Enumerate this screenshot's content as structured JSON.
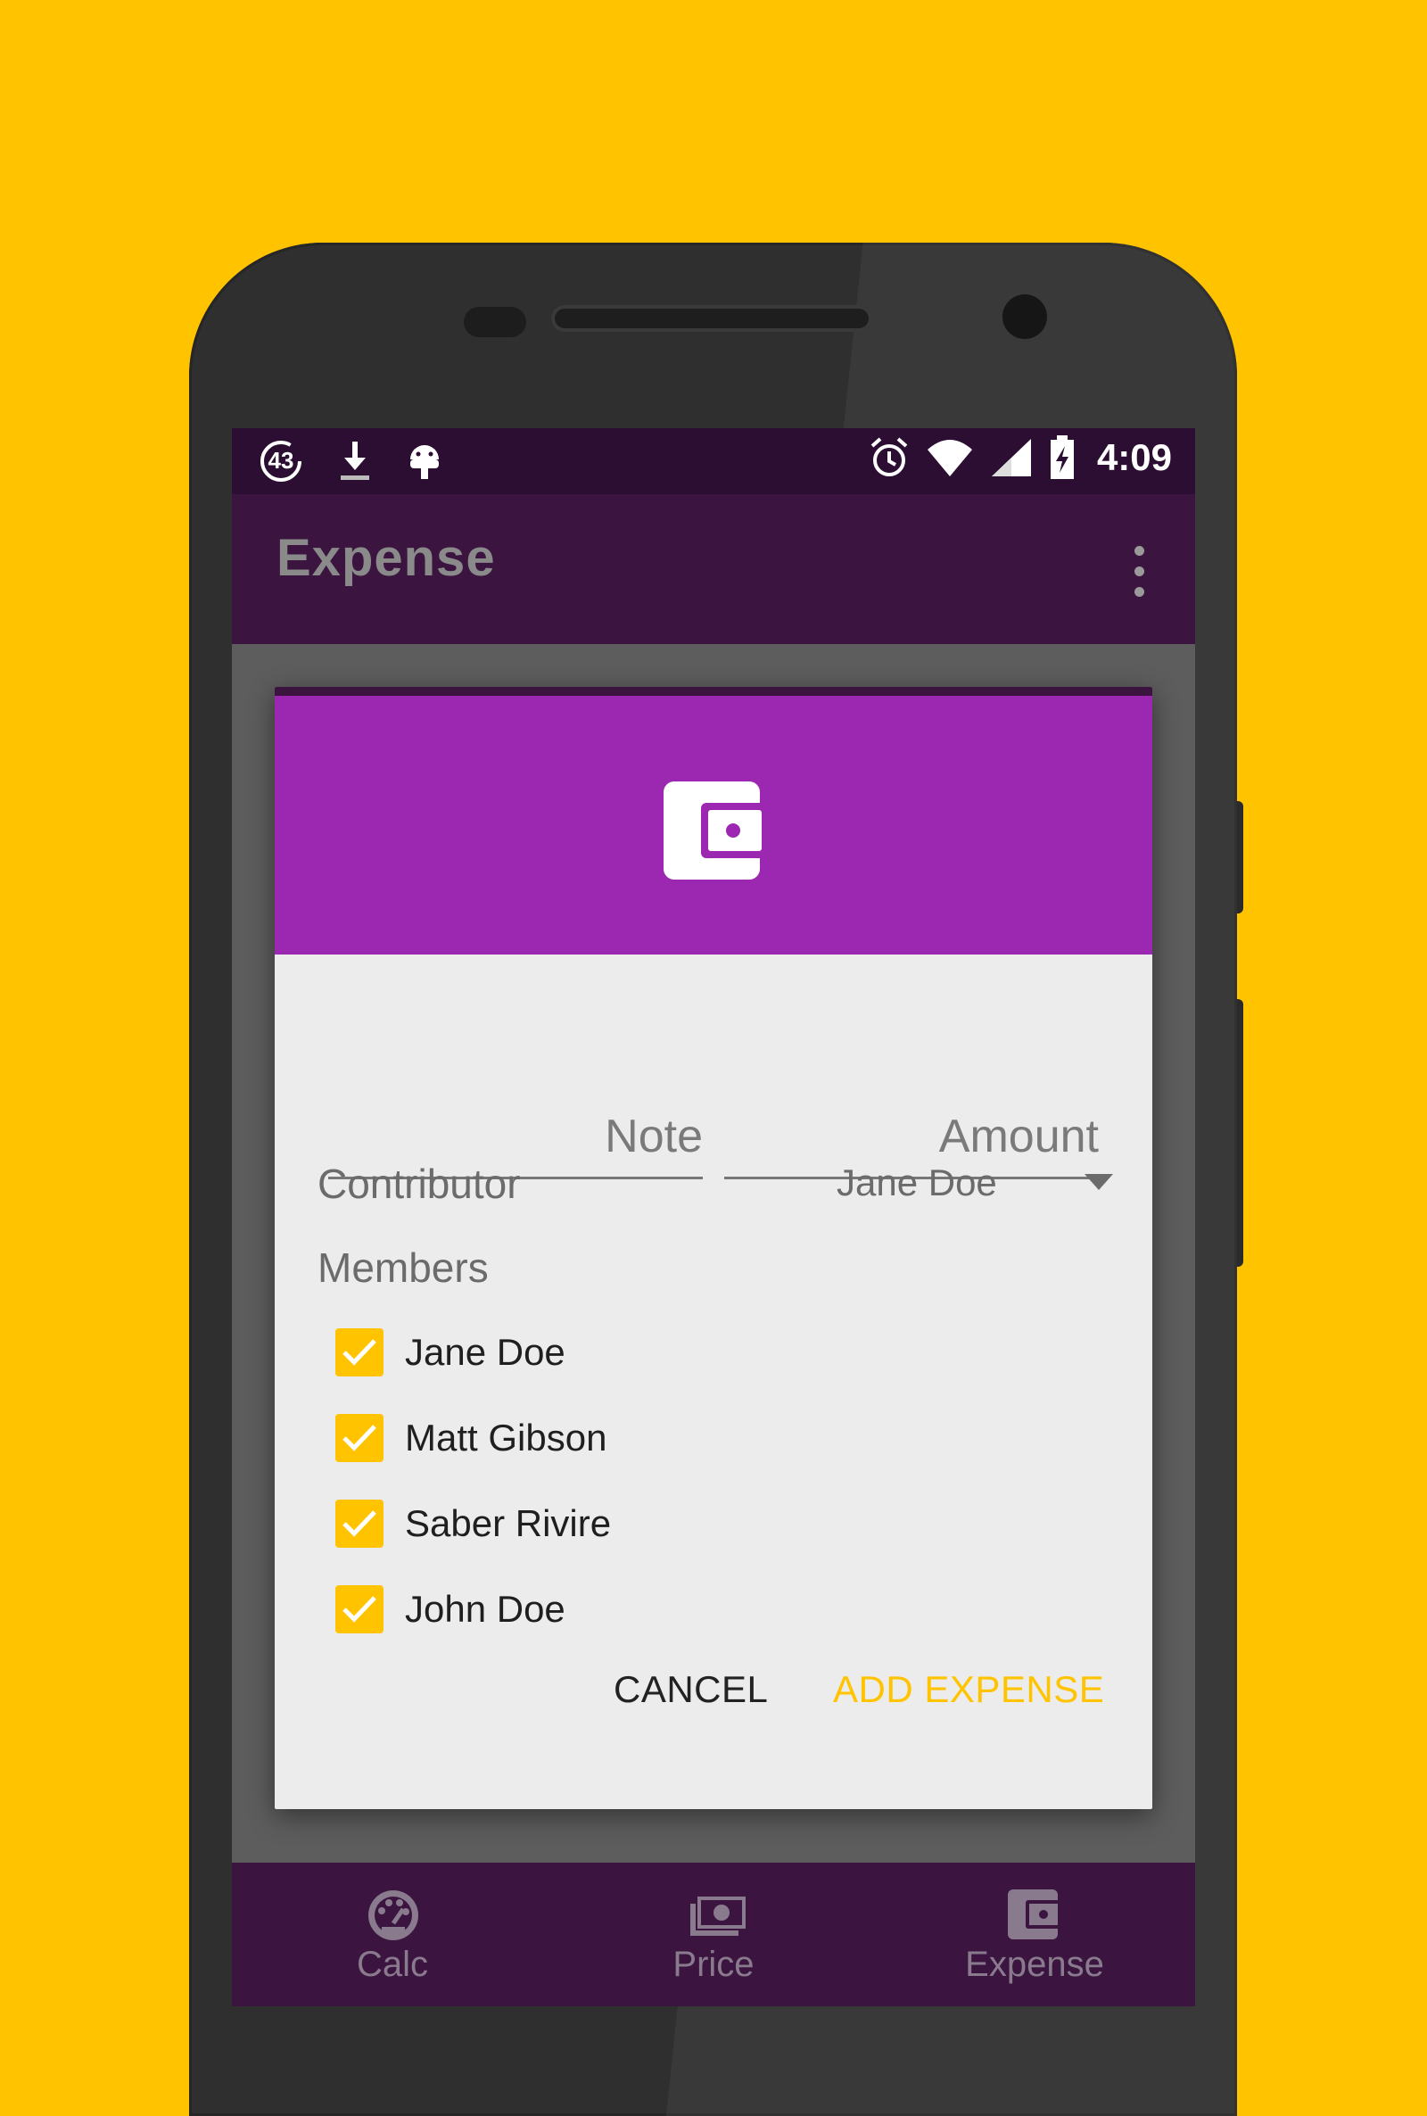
{
  "status_bar": {
    "notification_badge": "43",
    "time": "4:09",
    "icons": [
      "notification-count-icon",
      "download-icon",
      "android-icon",
      "alarm-icon",
      "wifi-icon",
      "signal-icon",
      "battery-charging-icon"
    ]
  },
  "app_bar": {
    "title": "Expense",
    "overflow_icon": "more-vert-icon"
  },
  "dialog": {
    "header_icon": "wallet-icon",
    "note_placeholder": "Note",
    "amount_placeholder": "Amount",
    "contributor_label": "Contributor",
    "contributor_value": "Jane Doe",
    "members_label": "Members",
    "members": [
      {
        "name": "Jane Doe",
        "checked": true
      },
      {
        "name": "Matt Gibson",
        "checked": true
      },
      {
        "name": "Saber Rivire",
        "checked": true
      },
      {
        "name": "John Doe",
        "checked": true
      }
    ],
    "cancel_label": "CANCEL",
    "add_label": "ADD EXPENSE"
  },
  "bottom_nav": {
    "items": [
      {
        "label": "Calc",
        "icon": "speedometer-icon"
      },
      {
        "label": "Price",
        "icon": "money-icon"
      },
      {
        "label": "Expense",
        "icon": "wallet-icon"
      }
    ]
  },
  "colors": {
    "background": "#FFC300",
    "accent": "#FFC300",
    "primary": "#9c27b0",
    "primary_dark": "#3b1540"
  }
}
